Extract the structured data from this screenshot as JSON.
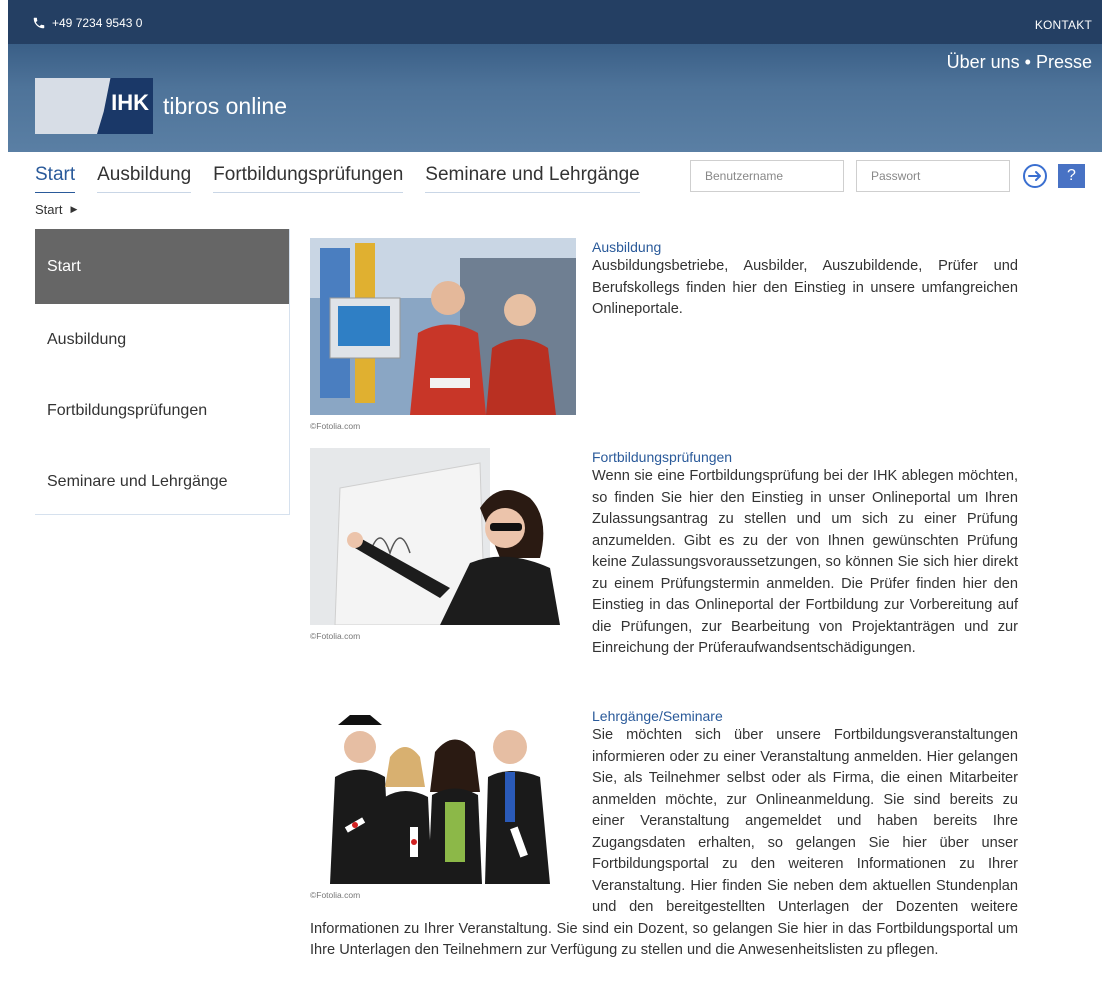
{
  "topbar": {
    "phone": "+49 7234 9543 0",
    "kontakt": "KONTAKT"
  },
  "header": {
    "meta_link_1": "Über uns",
    "separator": "•",
    "meta_link_2": "Presse",
    "logo_text": "IHK",
    "app_title": "tibros online"
  },
  "nav": {
    "items": [
      "Start",
      "Ausbildung",
      "Fortbildungsprüfungen",
      "Seminare und Lehrgänge"
    ],
    "active": 0
  },
  "login": {
    "username_placeholder": "Benutzername",
    "password_placeholder": "Passwort",
    "help_label": "?"
  },
  "breadcrumb": {
    "current": "Start"
  },
  "sidebar": {
    "items": [
      "Start",
      "Ausbildung",
      "Fortbildungsprüfungen",
      "Seminare und Lehrgänge"
    ],
    "active": 0
  },
  "sections": [
    {
      "title": "Ausbildung",
      "credit": "©Fotolia.com",
      "text": "Ausbildungsbetriebe, Ausbilder, Auszubildende, Prüfer und Berufskollegs finden hier den Einstieg in unsere umfangreichen Onlineportale."
    },
    {
      "title": "Fortbildungsprüfungen",
      "credit": "©Fotolia.com",
      "text": "Wenn sie eine Fortbildungsprüfung bei der IHK ablegen möchten, so finden Sie hier den Einstieg in unser Onlineportal um Ihren Zulassungsantrag zu stellen und um sich zu einer Prüfung anzumelden. Gibt es zu der von Ihnen gewünschten Prüfung keine Zulassungsvoraussetzungen, so können Sie sich hier direkt zu einem Prüfungstermin anmelden. Die Prüfer finden hier den Einstieg in das Onlineportal der Fortbildung zur Vorbereitung auf die Prüfungen, zur Bearbeitung von Projektanträgen und zur Einreichung der Prüferaufwandsentschädigungen."
    },
    {
      "title": "Lehrgänge/Seminare",
      "credit": "©Fotolia.com",
      "text": "Sie möchten sich über unsere Fortbildungsveranstaltungen informieren oder zu einer Veranstaltung anmelden. Hier gelangen Sie, als Teilnehmer selbst oder als Firma, die einen Mitarbeiter anmelden möchte, zur Onlineanmeldung. Sie sind bereits zu einer Veranstaltung angemeldet und haben bereits Ihre Zugangsdaten erhalten, so gelangen Sie hier über unser Fortbildungsportal zu den weiteren Informationen zu Ihrer Veranstaltung. Hier finden Sie neben dem aktuellen Stundenplan und den bereitgestellten Unterlagen der Dozenten weitere Informationen zu Ihrer Veranstaltung. Sie sind ein Dozent, so gelangen Sie hier in das Fortbildungsportal um Ihre Unterlagen den Teilnehmern zur Verfügung zu stellen und die Anwesenheitslisten zu pflegen."
    }
  ],
  "colors": {
    "topbar": "#243f63",
    "banner": "#4e7399",
    "accent": "#2a5a9a",
    "sidebar_active": "#666666",
    "help_button": "#4872c4"
  }
}
